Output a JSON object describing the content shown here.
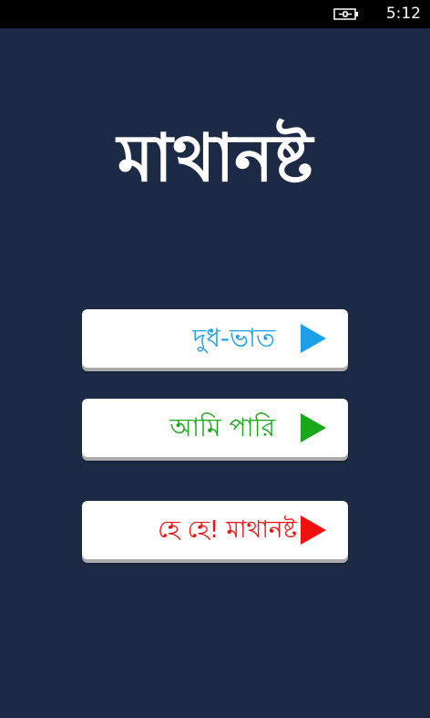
{
  "status_bar": {
    "time": "5:12",
    "battery_icon": "battery-charging-icon"
  },
  "app": {
    "title": "মাথানষ্ট"
  },
  "menu": {
    "buttons": [
      {
        "label": "দুধ-ভাত",
        "color": "#1ea0e8",
        "icon": "play-icon"
      },
      {
        "label": "আমি  পারি",
        "color": "#1aa81a",
        "icon": "play-icon"
      },
      {
        "label": "হে  হে!  মাথানষ্ট",
        "color": "#f01010",
        "icon": "play-icon"
      }
    ]
  }
}
